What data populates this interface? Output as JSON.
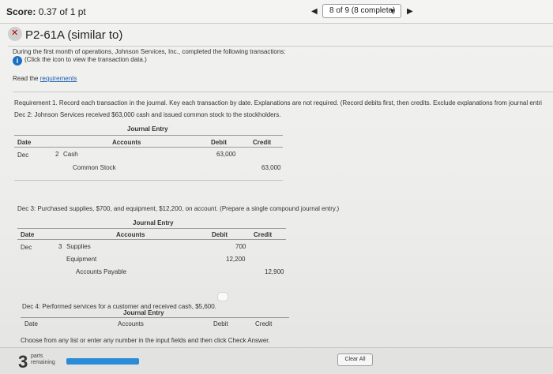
{
  "header": {
    "score_label": "Score:",
    "score_value": "0.37 of 1 pt",
    "pager_text": "8 of 9 (8 complete)",
    "caret": "▼",
    "prev_arrow": "◀",
    "next_arrow": "▶"
  },
  "question": {
    "title": "P2-61A (similar to)",
    "intro": "During the first month of operations, Johnson Services, Inc., completed the following transactions:",
    "data_link": "(Click the icon to view the transaction data.)",
    "read_prefix": "Read the ",
    "requirements_link": "requirements",
    "requirement_text": "Requirement 1. Record each transaction in the journal. Key each transaction by date. Explanations are not required. (Record debits first, then credits. Exclude explanations from journal entri"
  },
  "entries": [
    {
      "prompt": "Dec 2: Johnson Services received $63,000 cash and issued common stock to the stockholders.",
      "title": "Journal Entry",
      "headers": {
        "date": "Date",
        "accounts": "Accounts",
        "debit": "Debit",
        "credit": "Credit"
      },
      "month": "Dec",
      "day": "2",
      "rows": [
        {
          "account": "Cash",
          "debit": "63,000",
          "credit": ""
        },
        {
          "account": "Common Stock",
          "debit": "",
          "credit": "63,000"
        }
      ]
    },
    {
      "prompt": "Dec 3: Purchased supplies, $700, and equipment, $12,200, on account. (Prepare a single compound journal entry.)",
      "title": "Journal Entry",
      "headers": {
        "date": "Date",
        "accounts": "Accounts",
        "debit": "Debit",
        "credit": "Credit"
      },
      "month": "Dec",
      "day": "3",
      "rows": [
        {
          "account": "Supplies",
          "debit": "700",
          "credit": ""
        },
        {
          "account": "Equipment",
          "debit": "12,200",
          "credit": ""
        },
        {
          "account": "Accounts Payable",
          "debit": "",
          "credit": "12,900"
        }
      ]
    },
    {
      "prompt": "Dec 4: Performed services for a customer and received cash, $5,600.",
      "title": "Journal Entry",
      "headers": {
        "date": "Date",
        "accounts": "Accounts",
        "debit": "Debit",
        "credit": "Credit"
      }
    }
  ],
  "footer": {
    "helper_text": "Choose from any list or enter any number in the input fields and then click Check Answer.",
    "parts_count": "3",
    "parts_label_1": "parts",
    "parts_label_2": "remaining",
    "clear_all": "Clear All"
  },
  "colors": {
    "progress": "#2a8bd7",
    "link": "#1d5fb5",
    "info_icon": "#1b6fc1"
  }
}
